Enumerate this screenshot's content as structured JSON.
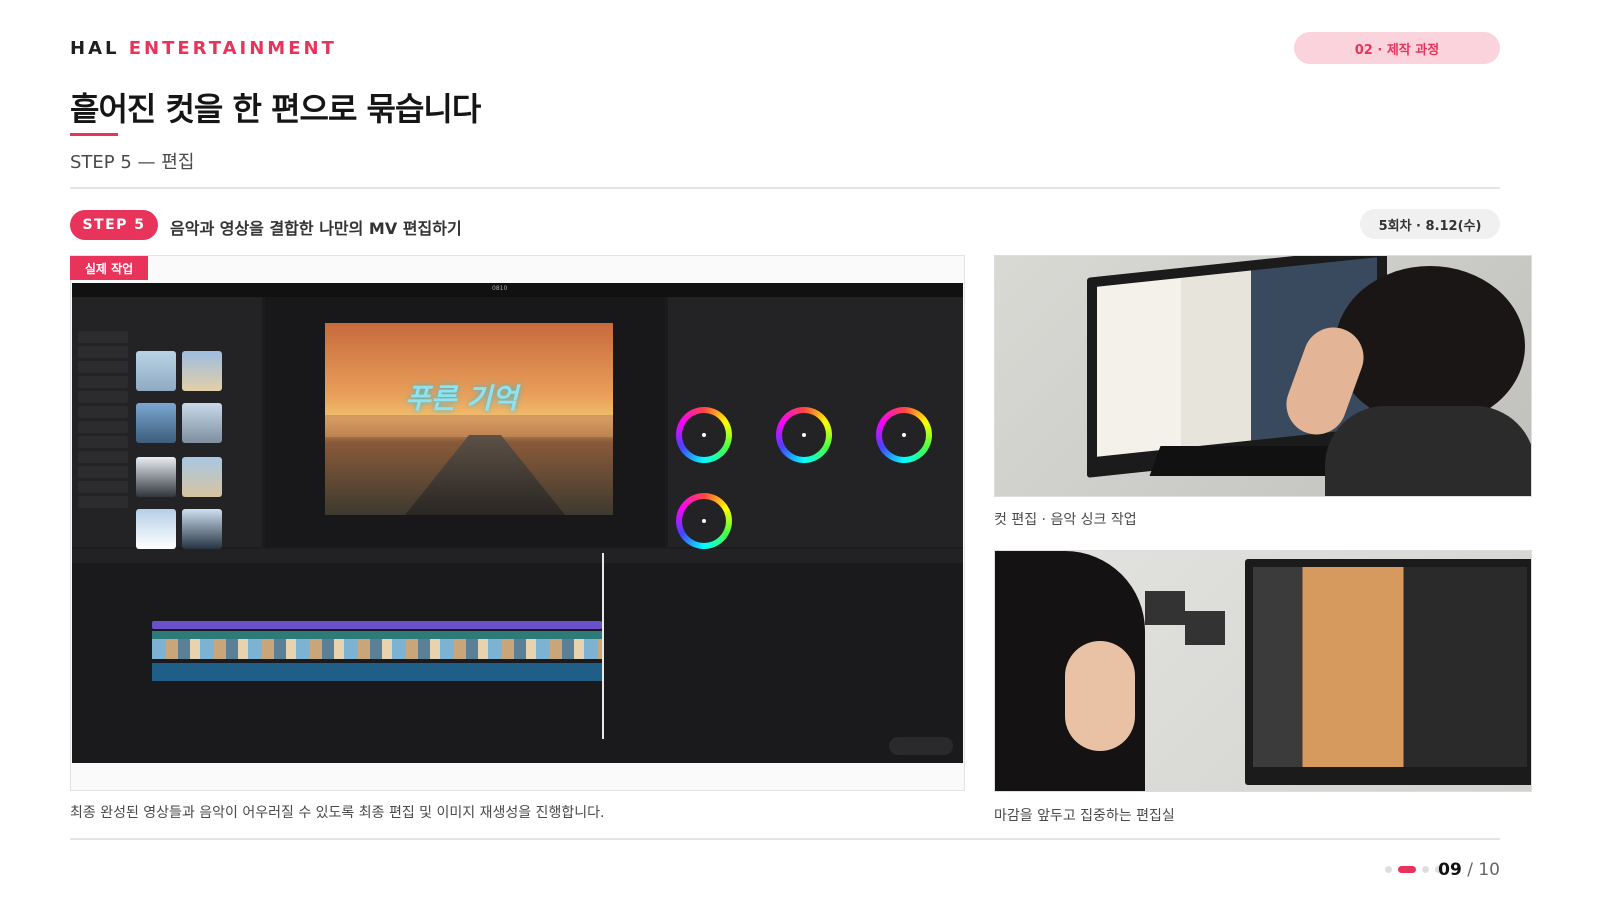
{
  "header": {
    "brand_part1": "HAL",
    "brand_part2": "ENTERTAINMENT",
    "section_label": "02 · 제작 과정",
    "title": "흩어진 컷을 한 편으로 묶습니다",
    "subtitle": "STEP 5 — 편집"
  },
  "step": {
    "badge": "STEP 5",
    "description": "음악과 영상을 결합한 나만의 MV 편집하기",
    "session": "5회차 · 8.12(수)"
  },
  "main_image": {
    "tag": "실제 작업",
    "caption": "최종 완성된 영상들과 음악이 어우러질 수 있도록 최종 편집 및 이미지 재생성을 진행합니다.",
    "editor_title": "0810",
    "overlay_text": "푸른 기억"
  },
  "photos": [
    {
      "caption": "컷 편집 · 음악 싱크 작업"
    },
    {
      "caption": "마감을 앞두고 집중하는 편집실"
    }
  ],
  "pagination": {
    "current": "09",
    "separator": " / ",
    "total": "10",
    "dots": 5,
    "active_dot": 2
  },
  "colors": {
    "accent": "#e8345a",
    "accent_light": "#fbd3dc"
  }
}
